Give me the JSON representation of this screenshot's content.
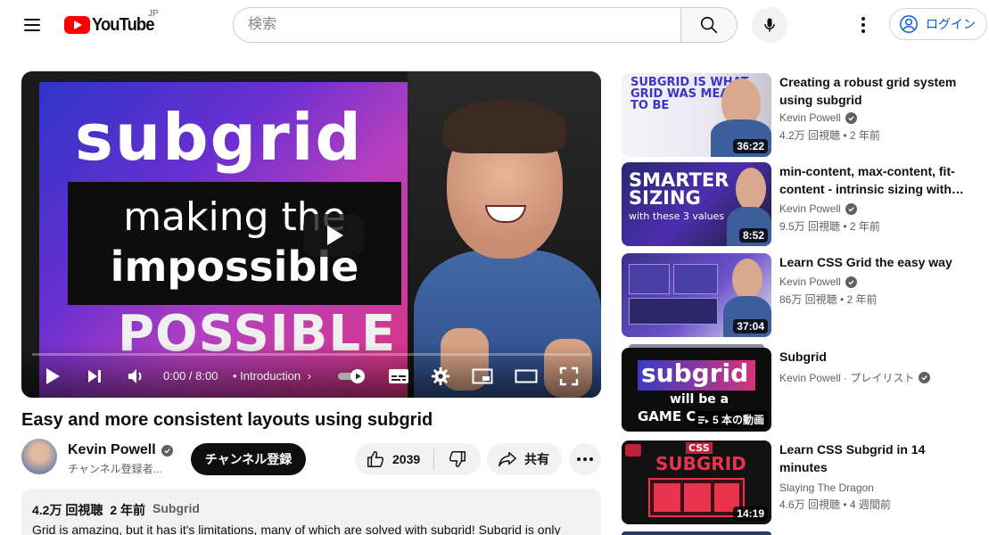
{
  "header": {
    "logo_text": "YouTube",
    "country_code": "JP",
    "search_placeholder": "検索",
    "login_label": "ログイン"
  },
  "player": {
    "thumbnail": {
      "line1": "subgrid",
      "line2": "making the",
      "line3": "impossible",
      "line4": "POSSIBLE"
    },
    "time": "0:00 / 8:00",
    "chapter": "• Introduction",
    "progress": 0
  },
  "video": {
    "title": "Easy and more consistent layouts using subgrid",
    "channel_name": "Kevin Powell",
    "subscribers": "チャンネル登録者...",
    "subscribe_label": "チャンネル登録",
    "likes": "2039",
    "share_label": "共有",
    "views": "4.2万 回視聴",
    "age": "2 年前",
    "tag": "Subgrid",
    "description": "Grid is amazing, but it has it's limitations, many of which are solved with subgrid! Subgrid is only"
  },
  "recommendations": [
    {
      "title": "Creating a robust grid system using subgrid",
      "channel": "Kevin Powell",
      "verified": true,
      "meta": "4.2万 回視聴 • 2 年前",
      "duration": "36:22",
      "thumb_text": [
        "SUBGRID IS WHAT",
        "GRID WAS MEANT",
        "TO BE"
      ]
    },
    {
      "title": "min-content, max-content, fit-content - intrinsic sizing with…",
      "channel": "Kevin Powell",
      "verified": true,
      "meta": "9.5万 回視聴 • 2 年前",
      "duration": "8:52",
      "thumb_text": [
        "SMARTER",
        "SIZING",
        "with these 3 values"
      ]
    },
    {
      "title": "Learn CSS Grid the easy way",
      "channel": "Kevin Powell",
      "verified": true,
      "meta": "86万 回視聴 • 2 年前",
      "duration": "37:04",
      "thumb_text": []
    },
    {
      "title": "Subgrid",
      "channel": "Kevin Powell · プレイリスト",
      "verified": true,
      "meta": "",
      "duration": "5 本の動画",
      "thumb_text": [
        "subgrid",
        "will be a",
        "GAME C"
      ]
    },
    {
      "title": "Learn CSS Subgrid in 14 minutes",
      "channel": "Slaying The Dragon",
      "verified": false,
      "meta": "4.6万 回視聴 • 4 週間前",
      "duration": "14:19",
      "thumb_text": [
        "CSS",
        "SUBGRID"
      ]
    }
  ],
  "colors": {
    "brand_red": "#ff0000",
    "link_blue": "#065fd4"
  }
}
